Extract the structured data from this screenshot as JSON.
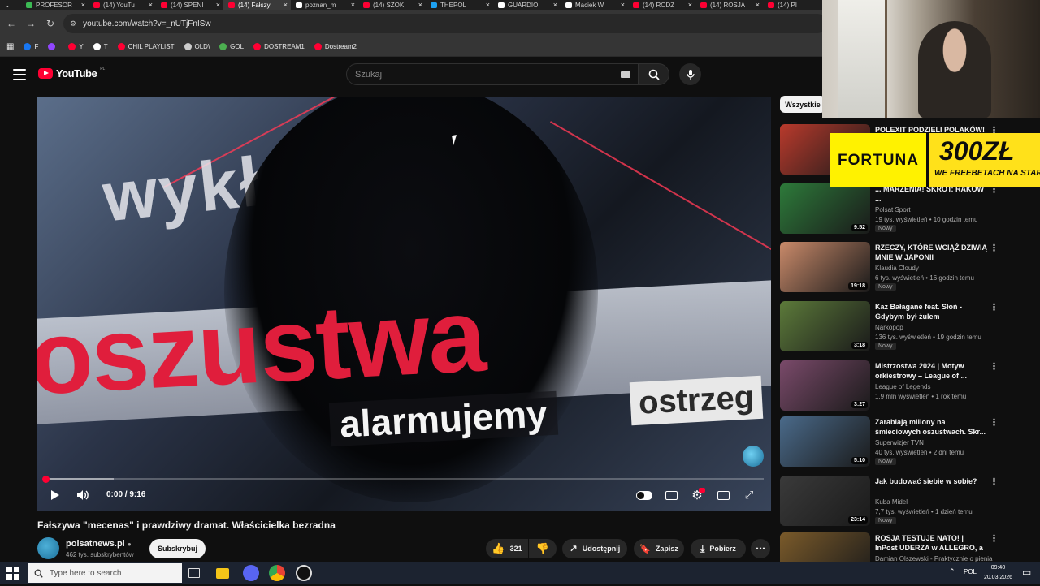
{
  "browser": {
    "tabs": [
      {
        "title": "PROFESOR",
        "fav": "#3cba54",
        "active": false
      },
      {
        "title": "(14) YouTu",
        "fav": "#ff0033",
        "active": false
      },
      {
        "title": "(14) SPENI",
        "fav": "#ff0033",
        "active": false
      },
      {
        "title": "(14) Fałszy",
        "fav": "#ff0033",
        "active": true
      },
      {
        "title": "poznan_m",
        "fav": "#ffffff",
        "active": false
      },
      {
        "title": "(14) SZOK",
        "fav": "#ff0033",
        "active": false
      },
      {
        "title": "THEPOL",
        "fav": "#1da1f2",
        "active": false
      },
      {
        "title": "GUARDIO",
        "fav": "#ffffff",
        "active": false
      },
      {
        "title": "Maciek W",
        "fav": "#ffffff",
        "active": false
      },
      {
        "title": "(14) RODZ",
        "fav": "#ff0033",
        "active": false
      },
      {
        "title": "(14) ROSJA",
        "fav": "#ff0033",
        "active": false
      },
      {
        "title": "(14) PI",
        "fav": "#ff0033",
        "active": false
      }
    ],
    "url": "youtube.com/watch?v=_nUTjFnISw",
    "bookmarks": [
      {
        "label": "F",
        "color": "#1877f2"
      },
      {
        "label": "",
        "color": "#9146ff"
      },
      {
        "label": "Y",
        "color": "#ff0033"
      },
      {
        "label": "T",
        "color": "#ffffff"
      },
      {
        "label": "CHIL PLAYLIST",
        "color": "#ff0033"
      },
      {
        "label": "OLD\\",
        "color": "#cccccc"
      },
      {
        "label": "GOL",
        "color": "#4caf50"
      },
      {
        "label": "DOSTREAM1",
        "color": "#ff0033"
      },
      {
        "label": "Dostream2",
        "color": "#ff0033"
      }
    ]
  },
  "youtube": {
    "logo_text": "YouTube",
    "country_code": "PL",
    "search_placeholder": "Szukaj"
  },
  "player": {
    "thumb_text_top": "wykł    enia",
    "thumb_text_main": "oszustwa",
    "thumb_text_sub": "alarmujemy",
    "thumb_text_right": "ostrzeg",
    "time": "0:00 / 9:16",
    "progress_fraction": 0.0,
    "buffered_fraction": 0.097
  },
  "video": {
    "title": "Fałszywa \"mecenas\" i prawdziwy dramat. Właścicielka bezradna",
    "channel": "polsatnews.pl",
    "subscribers": "462 tys. subskrybentów",
    "subscribe_label": "Subskrybuj",
    "likes": "321",
    "share_label": "Udostępnij",
    "save_label": "Zapisz",
    "download_label": "Pobierz"
  },
  "sidebar": {
    "chip_all": "Wszystkie",
    "recommendations": [
      {
        "title": "POLEXIT PODZIELI POLAKÓW!",
        "channel": "",
        "meta": "",
        "badge": "",
        "duration": "",
        "thumb_color": "#b93a2c"
      },
      {
        "title": "... MARZENIA! SKRÓT: RAKÓW ...",
        "channel": "Polsat Sport",
        "meta": "19 tys. wyświetleń • 10 godzin temu",
        "badge": "Nowy",
        "duration": "9:52",
        "thumb_color": "#2d7a3a"
      },
      {
        "title": "RZECZY, KTÓRE WCIĄŻ DZIWIĄ MNIE W JAPONII",
        "channel": "Klaudia Cloudy",
        "meta": "6 tys. wyświetleń • 16 godzin temu",
        "badge": "Nowy",
        "duration": "19:18",
        "thumb_color": "#c98a6a"
      },
      {
        "title": "Kaz Bałagane feat. Słoń - Gdybym był żulem",
        "channel": "Narkopop",
        "meta": "136 tys. wyświetleń • 19 godzin temu",
        "badge": "Nowy",
        "duration": "3:18",
        "thumb_color": "#5c7a3a"
      },
      {
        "title": "Mistrzostwa 2024 | Motyw orkiestrowy – League of ...",
        "channel": "League of Legends",
        "meta": "1,9 mln wyświetleń • 1 rok temu",
        "badge": "",
        "duration": "3:27",
        "thumb_color": "#7a4a6a"
      },
      {
        "title": "Zarabiają miliony na śmieciowych oszustwach. Skr...",
        "channel": "Superwizjer TVN",
        "meta": "40 tys. wyświetleń • 2 dni temu",
        "badge": "Nowy",
        "duration": "5:10",
        "thumb_color": "#4a6a8a"
      },
      {
        "title": "Jak budować siebie w sobie?",
        "channel": "Kuba Midel",
        "meta": "7,7 tys. wyświetleń • 1 dzień temu",
        "badge": "Nowy",
        "duration": "23:14",
        "thumb_color": "#3a3a3a"
      },
      {
        "title": "ROSJA TESTUJE NATO! | InPost UDERZA w ALLEGRO, a BAŁTY...",
        "channel": "Damian Olszewski - Praktycznie o pienia",
        "meta": "",
        "badge": "",
        "duration": "",
        "thumb_color": "#7a5a2a"
      }
    ]
  },
  "ad": {
    "brand": "FORTUNA",
    "amount": "300ZŁ",
    "subtitle": "WE FREEBETACH NA STAR"
  },
  "taskbar": {
    "search_placeholder": "Type here to search",
    "lang": "POL",
    "time": "09:40",
    "date": "20.03.2026"
  }
}
